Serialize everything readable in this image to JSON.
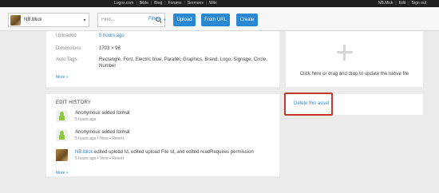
{
  "top_nav": {
    "links": [
      "Logos.com",
      "Bible",
      "Blog",
      "Forums",
      "Sermons",
      "Wiki"
    ],
    "user_links": [
      "NB.Mick",
      "Edit",
      "Sign out"
    ]
  },
  "toolbar": {
    "project": "NB.Mick",
    "search_placeholder": "Find…",
    "filters_label": "Filters",
    "upload_label": "Upload",
    "from_url_label": "From URL",
    "create_label": "Create"
  },
  "details": {
    "uploaded_label": "Uploaded",
    "uploaded_value": "5 hours ago",
    "dimensions_label": "Dimensions",
    "dimensions_value": "1703 × 96",
    "autotags_label": "Auto Tags",
    "autotags_value": "Rectangle, Font, Electric blue, Parallel, Graphics, Brand, Logo, Signage, Circle, Number",
    "more_label": "More »"
  },
  "history": {
    "title": "EDIT HISTORY",
    "items": [
      {
        "actor": "Anonymous",
        "action": " added format",
        "time": "5 hours ago",
        "links": ""
      },
      {
        "actor": "Anonymous",
        "action": " added format",
        "time": "5 hours ago",
        "links": " • View • Revert"
      },
      {
        "actor": "NB.Mick",
        "action": " edited upload Id,  edited upload File Id, and edited readRequires permission",
        "time": "5 hours ago",
        "links": " • View • Revert"
      }
    ],
    "more_label": "More »"
  },
  "drop": {
    "text": "Click here or drag and drop to update the native file"
  },
  "delete": {
    "label": "Delete this asset"
  },
  "colors": {
    "accent": "#2a88d2",
    "highlight": "#c0392b"
  }
}
